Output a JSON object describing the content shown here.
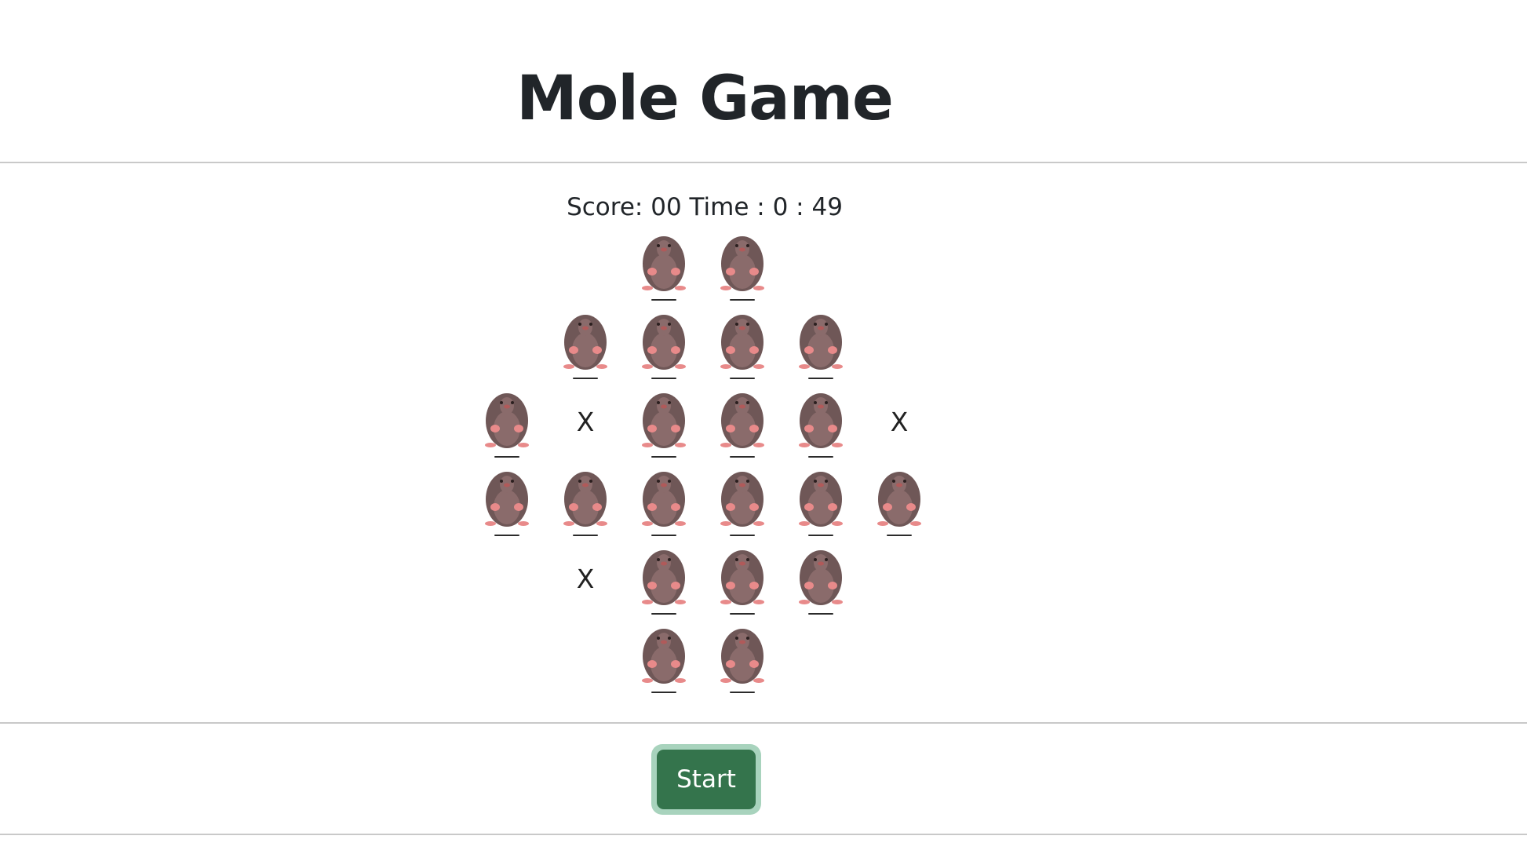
{
  "header": {
    "title": "Mole Game"
  },
  "status": {
    "score_label": "Score:",
    "score_value": "00",
    "time_label": "Time :",
    "time_minutes": "0",
    "time_separator": ":",
    "time_seconds": "49"
  },
  "board": {
    "rows": [
      [
        "empty",
        "empty",
        "mole",
        "mole",
        "empty",
        "empty"
      ],
      [
        "empty",
        "mole",
        "mole",
        "mole",
        "mole",
        "empty"
      ],
      [
        "mole",
        "miss",
        "mole",
        "mole",
        "mole",
        "miss"
      ],
      [
        "mole",
        "mole",
        "mole",
        "mole",
        "mole",
        "mole"
      ],
      [
        "empty",
        "miss",
        "mole",
        "mole",
        "mole",
        "empty"
      ],
      [
        "empty",
        "empty",
        "mole",
        "mole",
        "empty",
        "empty"
      ]
    ],
    "miss_symbol": "X",
    "mole_icon": "mole-icon"
  },
  "controls": {
    "start_label": "Start"
  },
  "colors": {
    "button_fill": "#34744c",
    "button_ring": "#a8d3bd",
    "mole_body": "#6f5757",
    "mole_paws": "#e88a8a"
  }
}
